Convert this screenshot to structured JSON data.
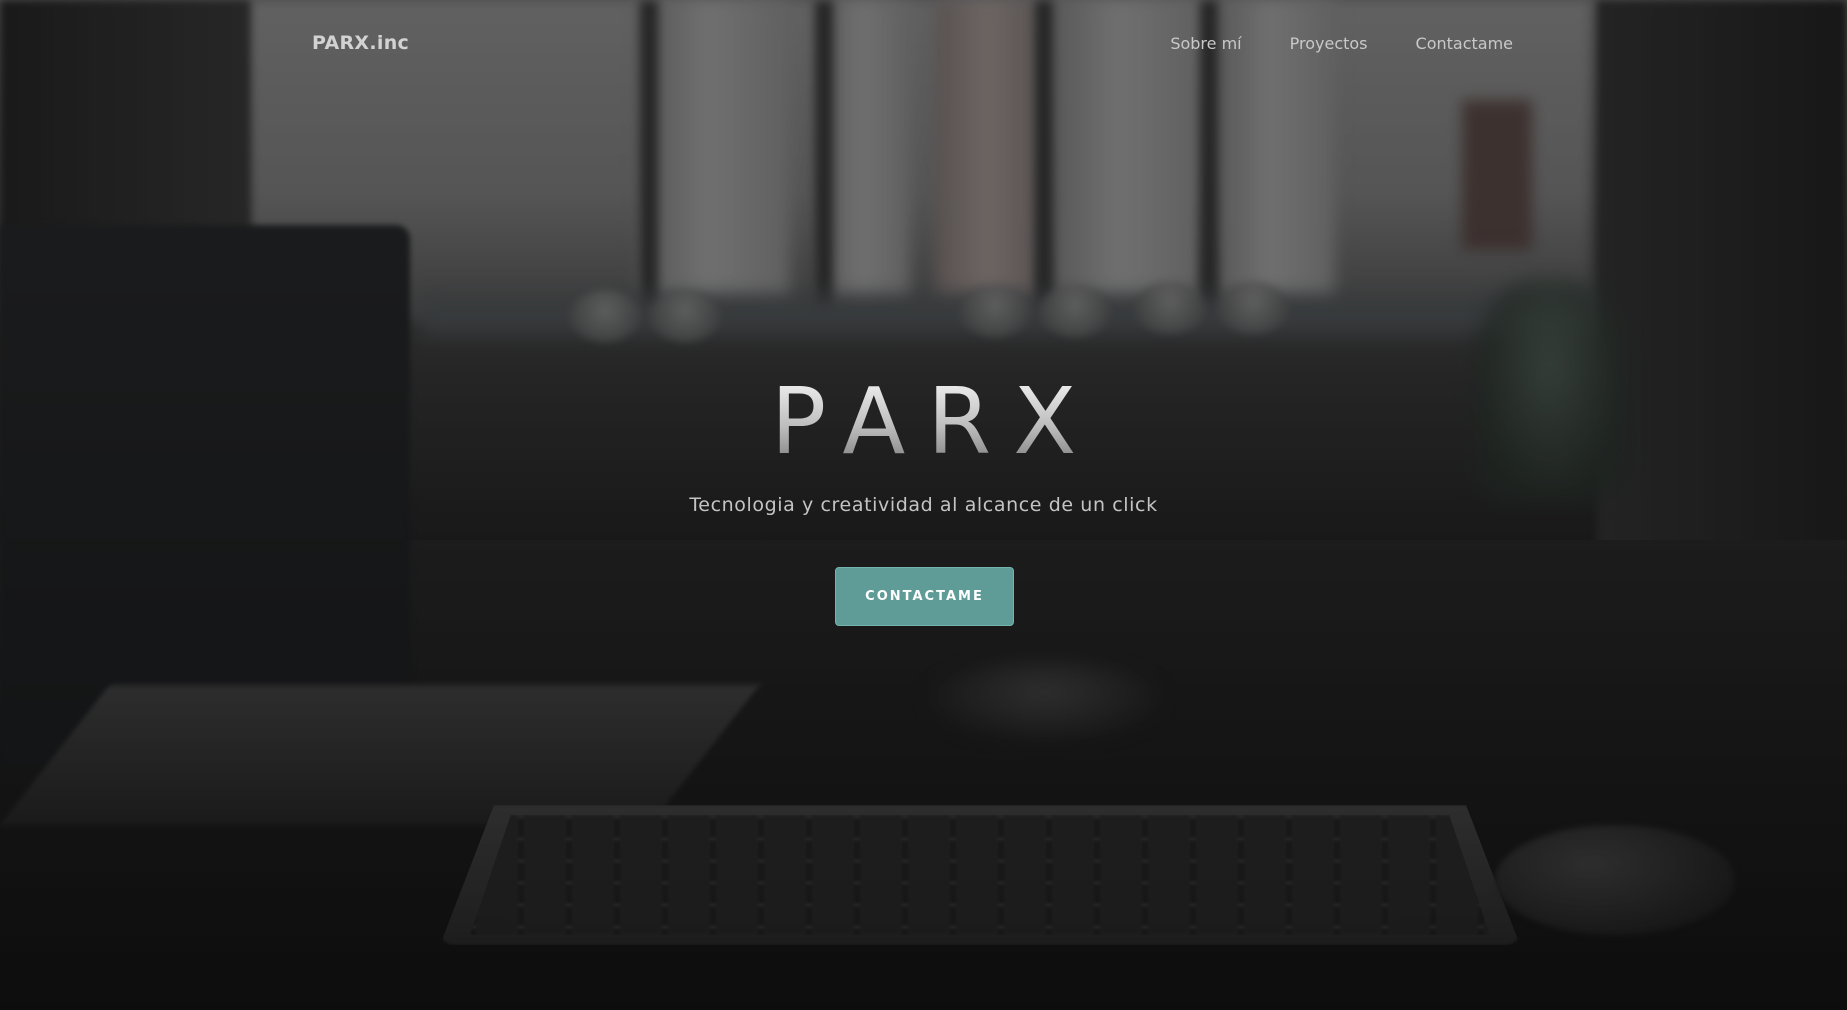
{
  "nav": {
    "brand": "PARX.inc",
    "links": [
      "Sobre mí",
      "Proyectos",
      "Contactame"
    ]
  },
  "hero": {
    "title": "PARX",
    "subtitle": "Tecnologia y creatividad al alcance de un click",
    "cta_label": "CONTACTAME"
  },
  "colors": {
    "accent": "#5f9c98",
    "overlay": "rgba(0,0,0,0.38)"
  }
}
